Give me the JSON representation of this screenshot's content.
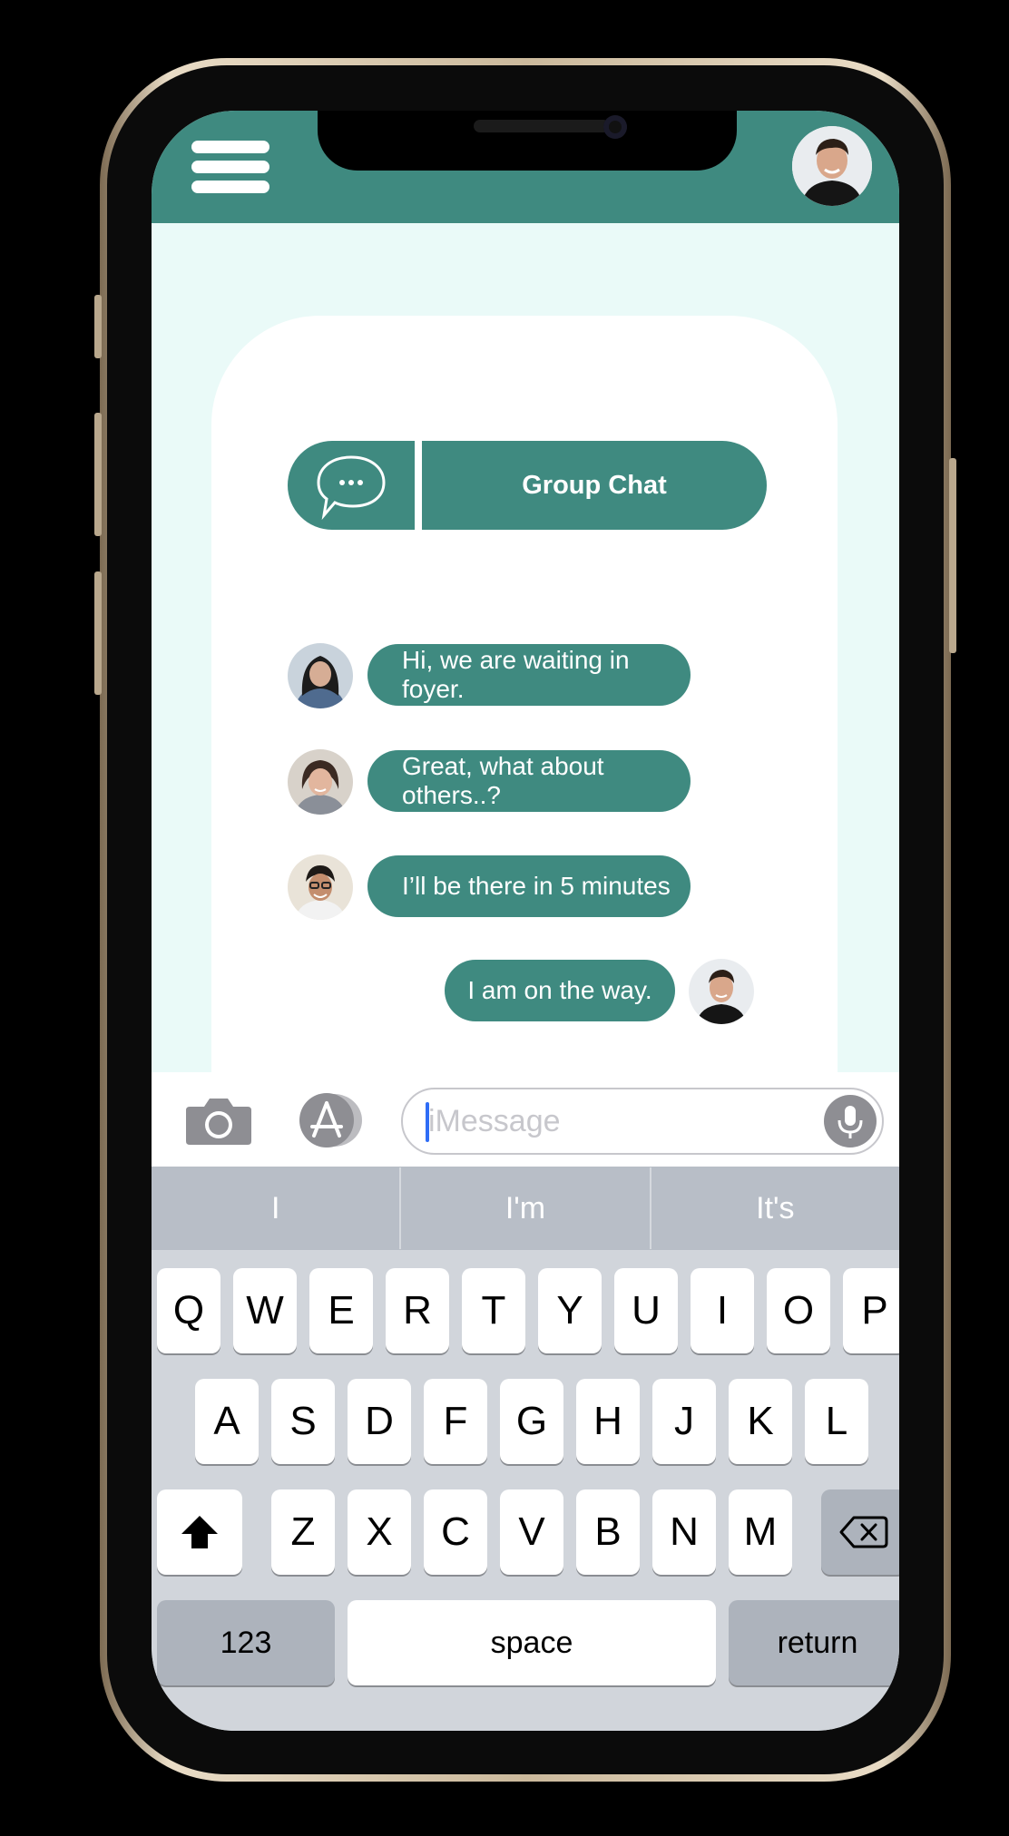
{
  "header": {
    "menu_icon": "hamburger-menu-icon",
    "profile_avatar_icon": "user-avatar"
  },
  "group_chat": {
    "icon": "speech-bubble-icon",
    "title": "Group Chat"
  },
  "messages": [
    {
      "text": "Hi, we are waiting in foyer.",
      "sender": "other"
    },
    {
      "text": "Great, what about others..?",
      "sender": "other"
    },
    {
      "text": "I’ll be there in 5 minutes",
      "sender": "other"
    },
    {
      "text": "I am on the way.",
      "sender": "self"
    }
  ],
  "composer": {
    "camera_icon": "camera-icon",
    "apps_icon": "app-store-icon",
    "placeholder": "iMessage",
    "mic_icon": "microphone-icon"
  },
  "suggestions": [
    "I",
    "I'm",
    "It's"
  ],
  "keyboard": {
    "row1": [
      "Q",
      "W",
      "E",
      "R",
      "T",
      "Y",
      "U",
      "I",
      "O",
      "P"
    ],
    "row2": [
      "A",
      "S",
      "D",
      "F",
      "G",
      "H",
      "J",
      "K",
      "L"
    ],
    "row3": [
      "Z",
      "X",
      "C",
      "V",
      "B",
      "N",
      "M"
    ],
    "numbers_label": "123",
    "space_label": "space",
    "return_label": "return",
    "shift_icon": "shift-icon",
    "delete_icon": "backspace-icon"
  },
  "colors": {
    "accent": "#3f8a80",
    "background": "#eafaf8"
  }
}
